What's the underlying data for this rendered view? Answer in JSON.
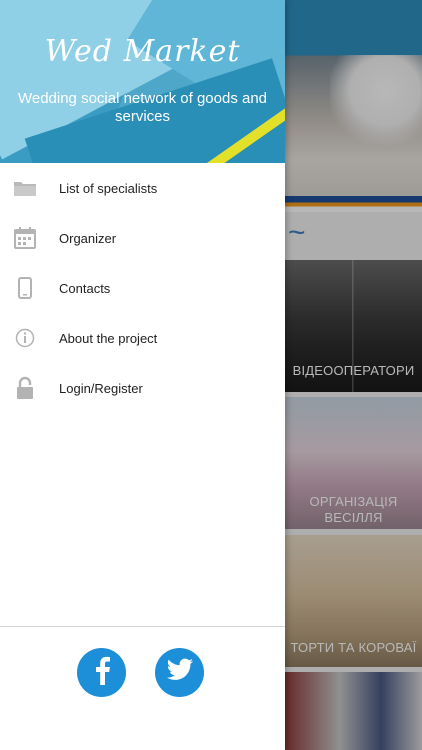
{
  "drawer": {
    "brand": "Wed Market",
    "tagline": "Wedding social network of goods and services",
    "menu": [
      {
        "label": "List of specialists",
        "icon": "folder-icon"
      },
      {
        "label": "Organizer",
        "icon": "calendar-icon"
      },
      {
        "label": "Contacts",
        "icon": "phone-icon"
      },
      {
        "label": "About the project",
        "icon": "info-icon"
      },
      {
        "label": "Login/Register",
        "icon": "lock-icon"
      }
    ],
    "social": [
      {
        "name": "facebook",
        "icon": "facebook-icon"
      },
      {
        "name": "twitter",
        "icon": "twitter-icon"
      }
    ]
  },
  "background": {
    "categories": [
      {
        "label": "ВІДЕООПЕРАТОРИ"
      },
      {
        "label": "ОРГАНІЗАЦІЯ ВЕСІЛЛЯ"
      },
      {
        "label": "ТОРТИ ТА КОРОВАЇ"
      },
      {
        "label": ""
      }
    ]
  },
  "colors": {
    "accent": "#1c8fd8",
    "header_blue": "#4ea7c9",
    "stripe_orange": "#f39a1d"
  }
}
